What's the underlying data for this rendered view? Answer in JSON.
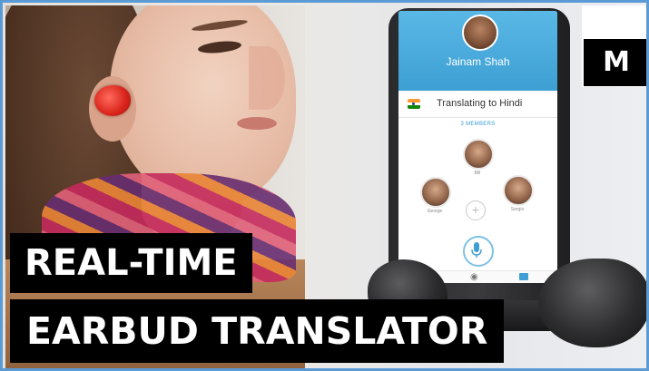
{
  "headline": {
    "line1": "REAL-TIME",
    "line2": "EARBUD TRANSLATOR"
  },
  "logo": {
    "letter": "M"
  },
  "phone_screen": {
    "contact_name": "Jainam Shah",
    "translating_label": "Translating to Hindi",
    "members_label": "3 MEMBERS",
    "members": [
      {
        "name": "Bill"
      },
      {
        "name": "George"
      },
      {
        "name": "Sergio"
      }
    ],
    "flag": "india-flag",
    "accent": "#3d9fd3"
  },
  "colors": {
    "frame_border": "#5b9bd5",
    "earbud_red": "#d8231a",
    "headline_bg": "#000000",
    "headline_text": "#ffffff"
  }
}
